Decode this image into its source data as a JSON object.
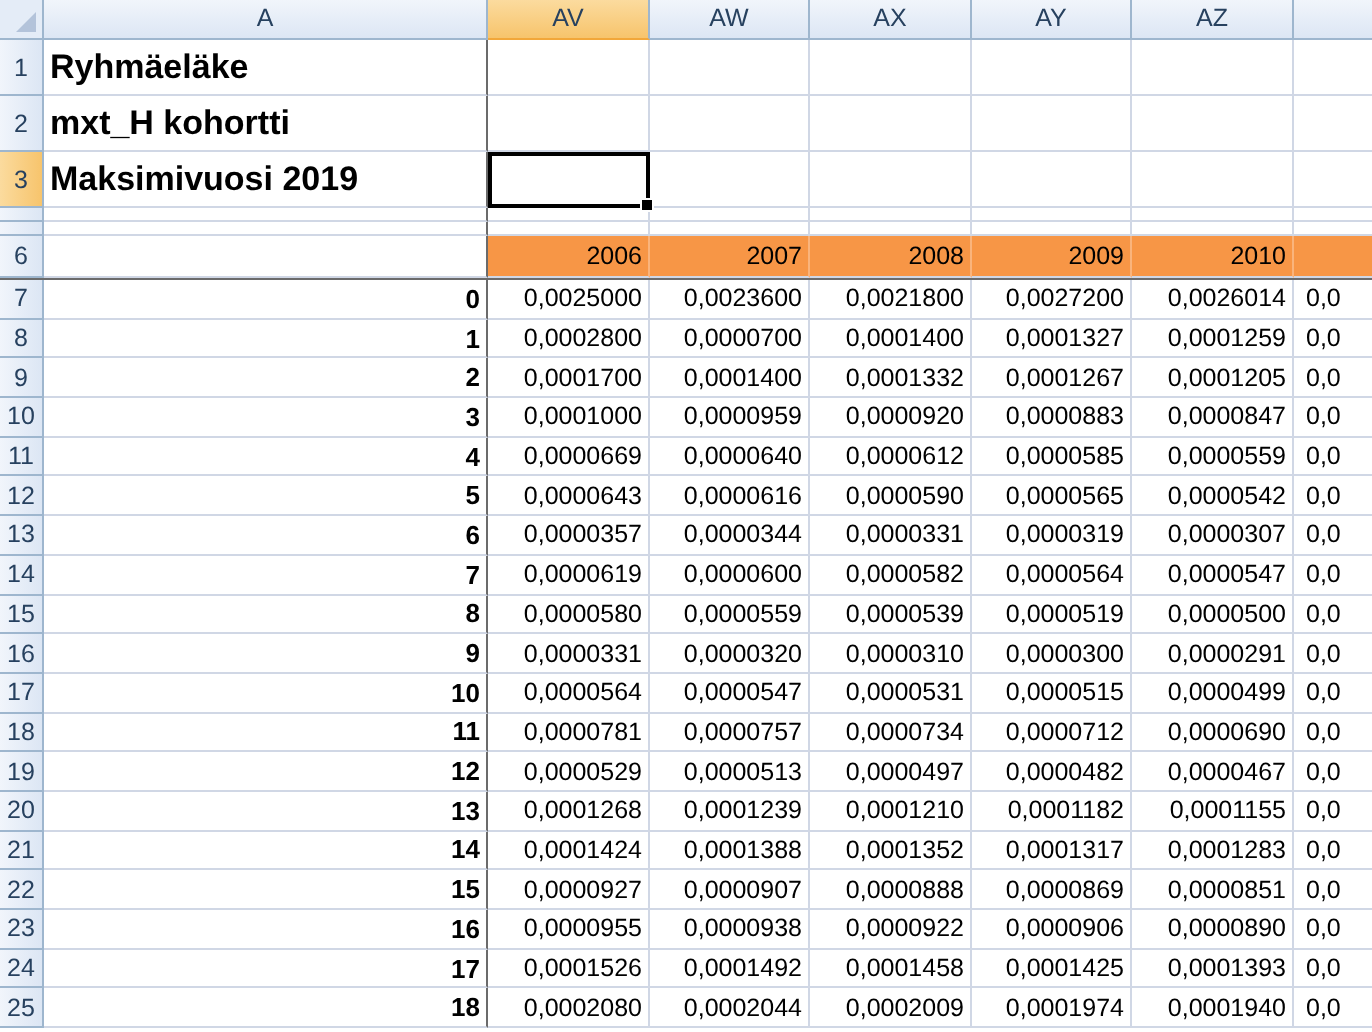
{
  "columns": [
    {
      "label": "A",
      "selected": false
    },
    {
      "label": "AV",
      "selected": true
    },
    {
      "label": "AW",
      "selected": false
    },
    {
      "label": "AX",
      "selected": false
    },
    {
      "label": "AY",
      "selected": false
    },
    {
      "label": "AZ",
      "selected": false
    },
    {
      "selected": false
    }
  ],
  "rows": [
    {
      "kind": "title",
      "header": "1",
      "selected": false,
      "label": "Ryhmäeläke"
    },
    {
      "kind": "title",
      "header": "2",
      "selected": false,
      "label": "mxt_H kohortti"
    },
    {
      "kind": "title",
      "header": "3",
      "selected": true,
      "label": "Maksimivuosi 2019"
    },
    {
      "kind": "spacer",
      "selected": false
    },
    {
      "kind": "spacer",
      "selected": false
    },
    {
      "kind": "year-header",
      "header": "6",
      "selected": false,
      "values": [
        "2006",
        "2007",
        "2008",
        "2009",
        "2010"
      ]
    },
    {
      "kind": "data",
      "header": "7",
      "selected": false,
      "label": "0",
      "values": [
        "0,0025000",
        "0,0023600",
        "0,0021800",
        "0,0027200",
        "0,0026014",
        "0,0"
      ]
    },
    {
      "kind": "data",
      "header": "8",
      "selected": false,
      "label": "1",
      "values": [
        "0,0002800",
        "0,0000700",
        "0,0001400",
        "0,0001327",
        "0,0001259",
        "0,0"
      ]
    },
    {
      "kind": "data",
      "header": "9",
      "selected": false,
      "label": "2",
      "values": [
        "0,0001700",
        "0,0001400",
        "0,0001332",
        "0,0001267",
        "0,0001205",
        "0,0"
      ]
    },
    {
      "kind": "data",
      "header": "10",
      "selected": false,
      "label": "3",
      "values": [
        "0,0001000",
        "0,0000959",
        "0,0000920",
        "0,0000883",
        "0,0000847",
        "0,0"
      ]
    },
    {
      "kind": "data",
      "header": "11",
      "selected": false,
      "label": "4",
      "values": [
        "0,0000669",
        "0,0000640",
        "0,0000612",
        "0,0000585",
        "0,0000559",
        "0,0"
      ]
    },
    {
      "kind": "data",
      "header": "12",
      "selected": false,
      "label": "5",
      "values": [
        "0,0000643",
        "0,0000616",
        "0,0000590",
        "0,0000565",
        "0,0000542",
        "0,0"
      ]
    },
    {
      "kind": "data",
      "header": "13",
      "selected": false,
      "label": "6",
      "values": [
        "0,0000357",
        "0,0000344",
        "0,0000331",
        "0,0000319",
        "0,0000307",
        "0,0"
      ]
    },
    {
      "kind": "data",
      "header": "14",
      "selected": false,
      "label": "7",
      "values": [
        "0,0000619",
        "0,0000600",
        "0,0000582",
        "0,0000564",
        "0,0000547",
        "0,0"
      ]
    },
    {
      "kind": "data",
      "header": "15",
      "selected": false,
      "label": "8",
      "values": [
        "0,0000580",
        "0,0000559",
        "0,0000539",
        "0,0000519",
        "0,0000500",
        "0,0"
      ]
    },
    {
      "kind": "data",
      "header": "16",
      "selected": false,
      "label": "9",
      "values": [
        "0,0000331",
        "0,0000320",
        "0,0000310",
        "0,0000300",
        "0,0000291",
        "0,0"
      ]
    },
    {
      "kind": "data",
      "header": "17",
      "selected": false,
      "label": "10",
      "values": [
        "0,0000564",
        "0,0000547",
        "0,0000531",
        "0,0000515",
        "0,0000499",
        "0,0"
      ]
    },
    {
      "kind": "data",
      "header": "18",
      "selected": false,
      "label": "11",
      "values": [
        "0,0000781",
        "0,0000757",
        "0,0000734",
        "0,0000712",
        "0,0000690",
        "0,0"
      ]
    },
    {
      "kind": "data",
      "header": "19",
      "selected": false,
      "label": "12",
      "values": [
        "0,0000529",
        "0,0000513",
        "0,0000497",
        "0,0000482",
        "0,0000467",
        "0,0"
      ]
    },
    {
      "kind": "data",
      "header": "20",
      "selected": false,
      "label": "13",
      "values": [
        "0,0001268",
        "0,0001239",
        "0,0001210",
        "0,0001182",
        "0,0001155",
        "0,0"
      ]
    },
    {
      "kind": "data",
      "header": "21",
      "selected": false,
      "label": "14",
      "values": [
        "0,0001424",
        "0,0001388",
        "0,0001352",
        "0,0001317",
        "0,0001283",
        "0,0"
      ]
    },
    {
      "kind": "data",
      "header": "22",
      "selected": false,
      "label": "15",
      "values": [
        "0,0000927",
        "0,0000907",
        "0,0000888",
        "0,0000869",
        "0,0000851",
        "0,0"
      ]
    },
    {
      "kind": "data",
      "header": "23",
      "selected": false,
      "label": "16",
      "values": [
        "0,0000955",
        "0,0000938",
        "0,0000922",
        "0,0000906",
        "0,0000890",
        "0,0"
      ]
    },
    {
      "kind": "data",
      "header": "24",
      "selected": false,
      "label": "17",
      "values": [
        "0,0001526",
        "0,0001492",
        "0,0001458",
        "0,0001425",
        "0,0001393",
        "0,0"
      ]
    },
    {
      "kind": "data",
      "header": "25",
      "selected": false,
      "label": "18",
      "values": [
        "0,0002080",
        "0,0002044",
        "0,0002009",
        "0,0001974",
        "0,0001940",
        "0,0"
      ]
    }
  ]
}
